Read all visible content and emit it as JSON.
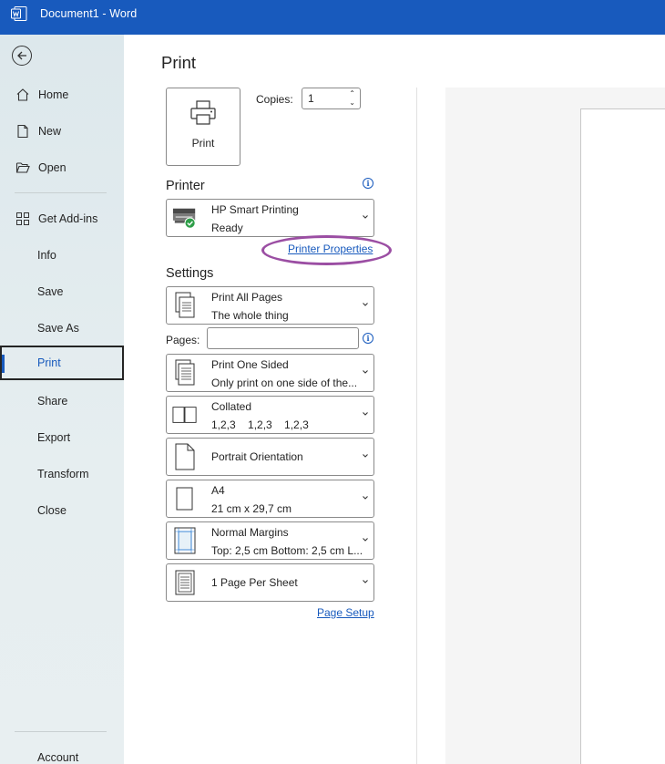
{
  "window": {
    "title": "Document1  -  Word"
  },
  "sidebar": {
    "items": [
      {
        "label": "Home"
      },
      {
        "label": "New"
      },
      {
        "label": "Open"
      },
      {
        "label": "Get Add-ins"
      },
      {
        "label": "Info"
      },
      {
        "label": "Save"
      },
      {
        "label": "Save As"
      },
      {
        "label": "Print"
      },
      {
        "label": "Share"
      },
      {
        "label": "Export"
      },
      {
        "label": "Transform"
      },
      {
        "label": "Close"
      },
      {
        "label": "Account"
      }
    ]
  },
  "main": {
    "title": "Print",
    "print_button": "Print",
    "copies": {
      "label": "Copies:",
      "value": "1"
    },
    "printer": {
      "heading": "Printer",
      "name": "HP Smart Printing",
      "status": "Ready",
      "properties_link": "Printer Properties"
    },
    "settings": {
      "heading": "Settings",
      "range": {
        "title": "Print All Pages",
        "subtitle": "The whole thing"
      },
      "pages_label": "Pages:",
      "pages_value": "",
      "sides": {
        "title": "Print One Sided",
        "subtitle": "Only print on one side of the..."
      },
      "collation": {
        "title": "Collated",
        "subtitle": "1,2,3    1,2,3    1,2,3"
      },
      "orientation": {
        "title": "Portrait Orientation"
      },
      "paper": {
        "title": "A4",
        "subtitle": "21 cm x 29,7 cm"
      },
      "margins": {
        "title": "Normal Margins",
        "subtitle": "Top: 2,5 cm Bottom: 2,5 cm L..."
      },
      "per_sheet": {
        "title": "1 Page Per Sheet"
      },
      "page_setup_link": "Page Setup"
    }
  },
  "colors": {
    "titlebar": "#185abd",
    "highlight": "#9b4ea3",
    "link": "#185abd"
  }
}
